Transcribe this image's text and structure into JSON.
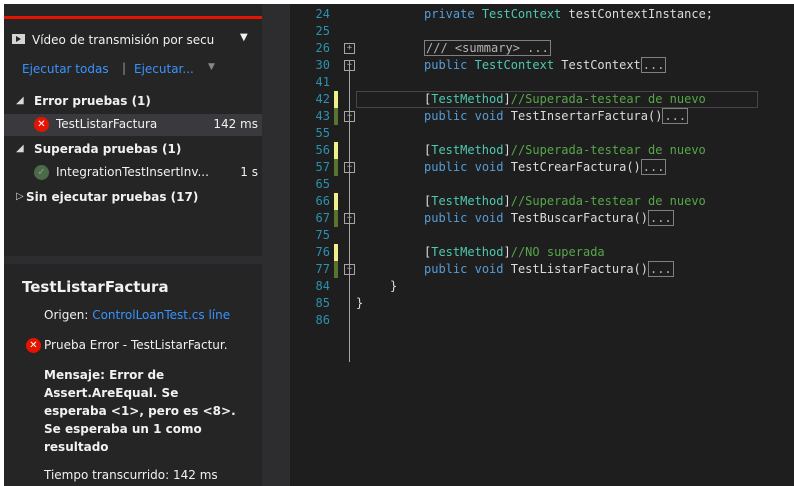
{
  "explorer": {
    "playlist_label": "Vídeo de transmisión por secu",
    "run_all_link": "Ejecutar todas",
    "separator": "|",
    "run_link": "Ejecutar...",
    "groups": [
      {
        "label": "Error pruebas (1)",
        "expanded": true
      },
      {
        "label": "Superada pruebas (1)",
        "expanded": true
      },
      {
        "label": "Sin ejecutar pruebas (17)",
        "expanded": false
      }
    ],
    "tests": [
      {
        "name": "TestListarFactura",
        "time": "142 ms",
        "status": "failed"
      },
      {
        "name": "IntegrationTestInsertInv...",
        "time": "1 s",
        "status": "passed"
      }
    ],
    "detail": {
      "title": "TestListarFactura",
      "source_label": "Origen:",
      "source_link": "ControlLoanTest.cs líne",
      "error_title": "Prueba Error - TestListarFactur.",
      "message": "Mensaje: Error de Assert.AreEqual. Se esperaba <1>, pero es <8>. Se esperaba un 1 como resultado",
      "elapsed": "Tiempo transcurrido: 142 ms"
    },
    "colors": {
      "failed": "#e51400",
      "link": "#3794ff",
      "top_bar": "#e51400"
    }
  },
  "editor": {
    "lines": [
      {
        "num": "24",
        "code": "private TestContext testContextInstance;"
      },
      {
        "num": "25",
        "code": ""
      },
      {
        "num": "26",
        "code": "/// <summary> ..."
      },
      {
        "num": "30",
        "code": "public TestContext TestContext",
        "collapsed": "..."
      },
      {
        "num": "41",
        "code": ""
      },
      {
        "num": "42",
        "code": "[TestMethod]//Superada-testear de nuevo"
      },
      {
        "num": "43",
        "code": "public void TestInsertarFactura()",
        "collapsed": "..."
      },
      {
        "num": "55",
        "code": ""
      },
      {
        "num": "56",
        "code": "[TestMethod]//Superada-testear de nuevo"
      },
      {
        "num": "57",
        "code": "public void TestCrearFactura()",
        "collapsed": "..."
      },
      {
        "num": "65",
        "code": ""
      },
      {
        "num": "66",
        "code": "[TestMethod]//Superada-testear de nuevo"
      },
      {
        "num": "67",
        "code": "public void TestBuscarFactura()",
        "collapsed": "..."
      },
      {
        "num": "75",
        "code": ""
      },
      {
        "num": "76",
        "code": "[TestMethod]//NO superada"
      },
      {
        "num": "77",
        "code": "public void TestListarFactura()",
        "collapsed": "..."
      },
      {
        "num": "84",
        "code": "}"
      },
      {
        "num": "85",
        "code": "}"
      },
      {
        "num": "86",
        "code": ""
      }
    ],
    "colors": {
      "keyword": "#569cd6",
      "type": "#4ec9b0",
      "comment": "#57a64a",
      "line_number": "#2b91af"
    }
  }
}
